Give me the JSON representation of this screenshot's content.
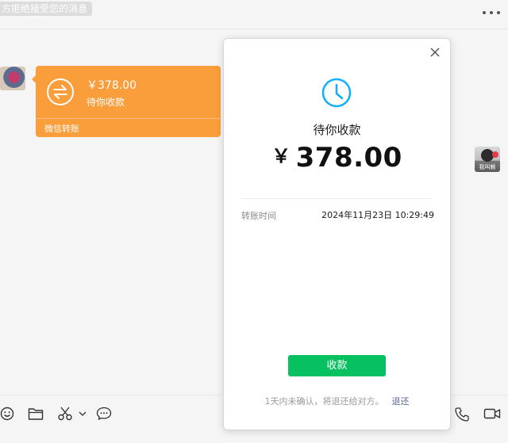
{
  "header": {
    "notice": "方拒绝接受您的消息",
    "more_icon": "more-icon"
  },
  "chat": {
    "transfer_bubble": {
      "amount": "￥378.00",
      "status": "待你收款",
      "footer": "微信转账",
      "icon": "transfer-arrows-icon",
      "color": "#fa9d3b"
    },
    "right_avatar_caption": "我叫赖"
  },
  "toolbar": {
    "icons": [
      "emoji-icon",
      "folder-icon",
      "scissors-icon",
      "chevron-down-icon",
      "chat-bubble-icon",
      "phone-icon",
      "video-icon"
    ]
  },
  "modal": {
    "status": "待你收款",
    "currency": "￥",
    "amount": "378.00",
    "time_label": "转账时间",
    "time_value": "2024年11月23日 10:29:49",
    "receive_button": "收款",
    "note": "1天内未确认，将退还给对方。",
    "return_link": "退还",
    "accent_color": "#07c160",
    "clock_color": "#10aeff"
  }
}
